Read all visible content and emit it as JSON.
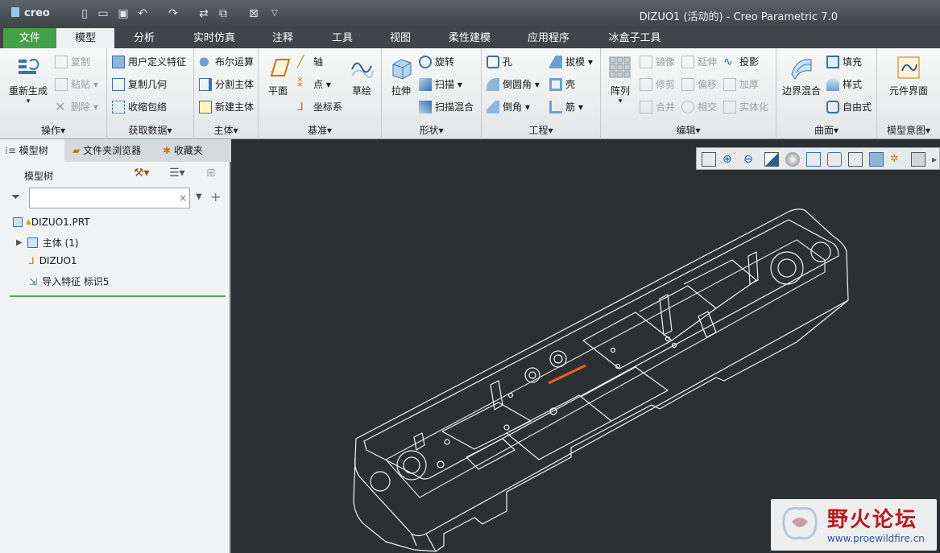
{
  "app": {
    "logo": "creo",
    "title": "DIZUO1 (活动的) - Creo Parametric 7.0"
  },
  "quick_access": [
    "new-icon",
    "open-icon",
    "save-icon",
    "undo-icon",
    "redo-icon",
    "regenerate-icon",
    "windows-icon",
    "close-window-icon",
    "customize-icon"
  ],
  "tabs": [
    "文件",
    "模型",
    "分析",
    "实时仿真",
    "注释",
    "工具",
    "视图",
    "柔性建模",
    "应用程序",
    "冰盒子工具"
  ],
  "active_tab": "模型",
  "ribbon": {
    "operations": {
      "label": "操作▾",
      "regenerate": "重新生成",
      "copy": "复制",
      "paste": "粘贴",
      "delete": "删除"
    },
    "get_data": {
      "label": "获取数据▾",
      "udf": "用户定义特征",
      "copy_geom": "复制几何",
      "shrinkwrap": "收缩包络"
    },
    "body": {
      "label": "主体▾",
      "boolean": "布尔运算",
      "split": "分割主体",
      "new_body": "新建主体"
    },
    "datum": {
      "label": "基准▾",
      "plane": "平面",
      "axis": "轴",
      "point": "点",
      "csys": "坐标系",
      "sketch": "草绘"
    },
    "shapes": {
      "label": "形状▾",
      "extrude": "拉伸",
      "revolve": "旋转",
      "sweep": "扫描",
      "swept_blend": "扫描混合"
    },
    "engineering": {
      "label": "工程▾",
      "hole": "孔",
      "round": "倒圆角",
      "chamfer": "倒角",
      "draft": "拔模",
      "shell": "壳",
      "rib": "筋"
    },
    "editing": {
      "label": "编辑▾",
      "pattern": "阵列",
      "mirror": "镜像",
      "trim": "修剪",
      "merge": "合并",
      "extend": "延伸",
      "offset": "偏移",
      "intersect": "相交",
      "project": "投影",
      "thicken": "加厚",
      "solidify": "实体化"
    },
    "surfaces": {
      "label": "曲面▾",
      "boundary_blend": "边界混合",
      "fill": "填充",
      "style": "样式",
      "freestyle": "自由式"
    },
    "model_intent": {
      "label": "模型意图▾",
      "component_interface": "元件界面"
    }
  },
  "panel": {
    "tabs": [
      "模型树",
      "文件夹浏览器",
      "收藏夹"
    ],
    "model_tree_label": "模型树",
    "filter_placeholder": "",
    "tree": [
      "DIZUO1.PRT",
      "主体 (1)",
      "DIZUO1",
      "导入特征 标识5"
    ]
  },
  "view_toolbar": [
    "refit-icon",
    "zoom-in-icon",
    "zoom-out-icon",
    "repaint-icon",
    "display-style-icon",
    "saved-views-icon",
    "view-manager-icon",
    "perspective-icon",
    "section-icon",
    "datum-display-icon",
    "spin-center-icon",
    "annotation-display-icon"
  ],
  "watermark": {
    "title": "野火论坛",
    "url": "www.proewildfire.cn"
  },
  "colors": {
    "file_tab": "#45a04a",
    "highlight_edge": "#e8621c",
    "viewport_bg": "#2c3033"
  }
}
